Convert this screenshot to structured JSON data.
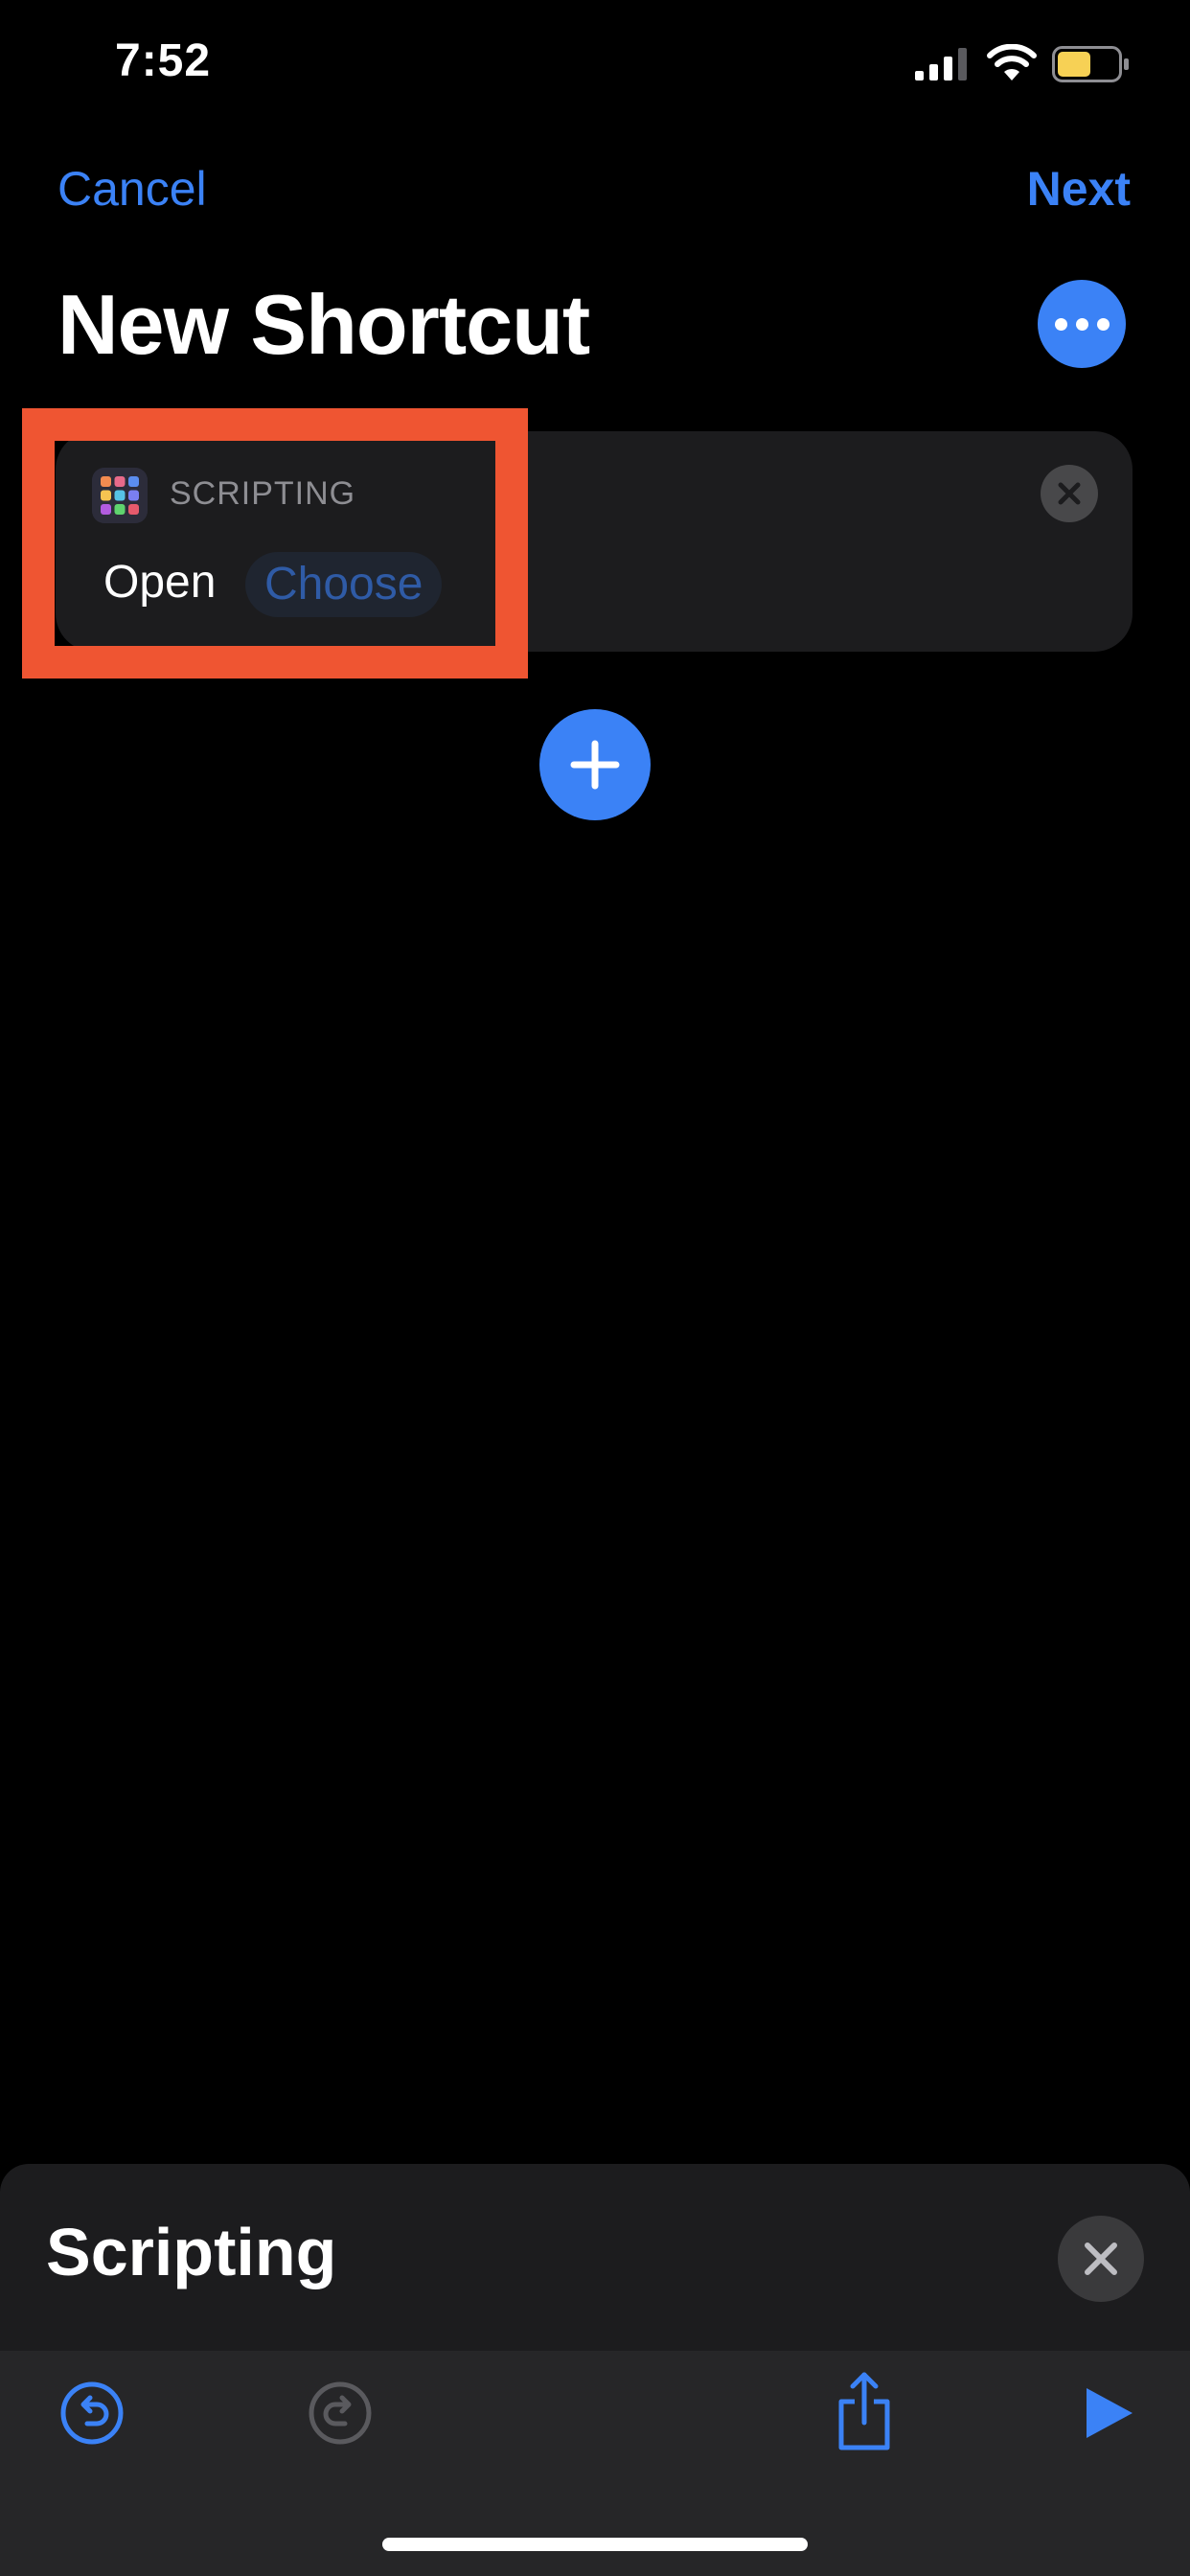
{
  "status_bar": {
    "time": "7:52",
    "icons": [
      "cellular-signal-icon",
      "wifi-icon",
      "battery-icon"
    ],
    "battery_color": "#f7d155"
  },
  "nav": {
    "cancel_label": "Cancel",
    "next_label": "Next",
    "title": "New Shortcut",
    "more_icon": "ellipsis-icon"
  },
  "action_card": {
    "app_icon": "scripting-grid-icon",
    "category": "SCRIPTING",
    "verb": "Open",
    "parameter_placeholder": "Choose",
    "remove_icon": "close-icon"
  },
  "add_action": {
    "icon": "plus-icon"
  },
  "bottom_sheet": {
    "title": "Scripting",
    "close_icon": "close-icon"
  },
  "toolbar": {
    "icons": [
      "undo-icon",
      "redo-icon",
      "share-icon",
      "play-icon"
    ]
  },
  "colors": {
    "accent": "#3b82f6",
    "highlight": "#ef5532",
    "background": "#000000",
    "card": "#1c1c1e"
  }
}
